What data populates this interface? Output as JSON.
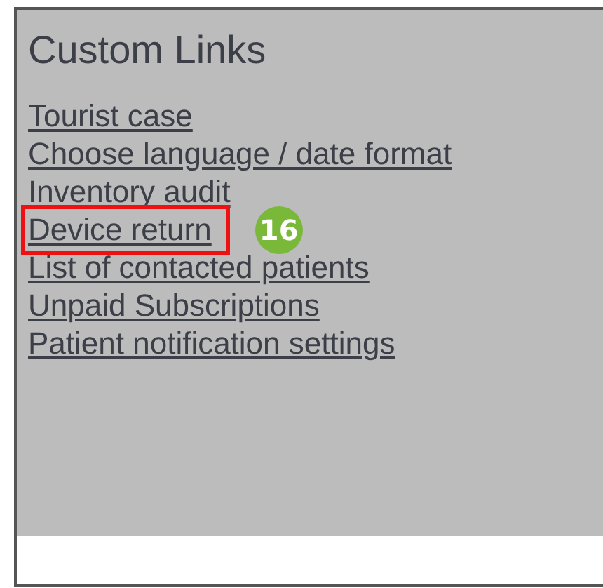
{
  "panel": {
    "title": "Custom Links",
    "links": [
      {
        "label": "Tourist case",
        "highlighted": false
      },
      {
        "label": "Choose language / date format",
        "highlighted": false
      },
      {
        "label": "Inventory audit",
        "highlighted": false
      },
      {
        "label": "Device return",
        "highlighted": true,
        "callout": "16"
      },
      {
        "label": "List of contacted patients",
        "highlighted": false
      },
      {
        "label": "Unpaid Subscriptions",
        "highlighted": false
      },
      {
        "label": "Patient notification settings",
        "highlighted": false
      }
    ]
  }
}
